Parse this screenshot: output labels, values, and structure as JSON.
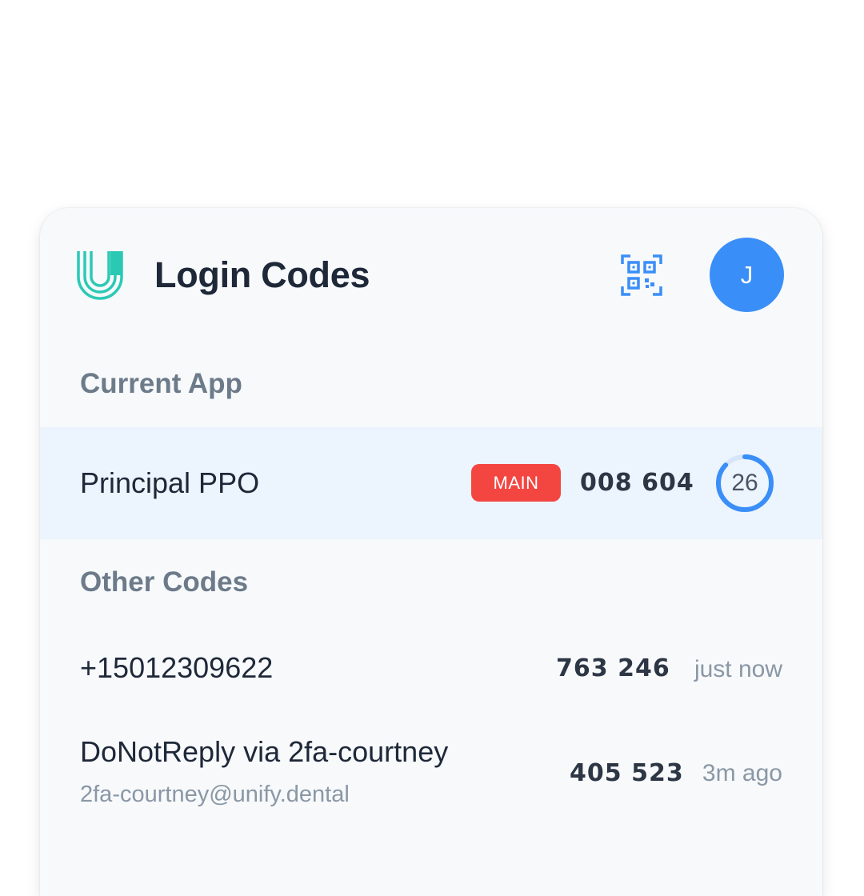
{
  "header": {
    "title": "Login Codes",
    "avatar_initial": "J",
    "icons": {
      "logo": "unify-logo",
      "scan": "qr-code-icon"
    }
  },
  "current_app": {
    "section_label": "Current App",
    "name": "Principal PPO",
    "badge": "MAIN",
    "code": "008 604",
    "seconds_remaining": "26",
    "timer_fraction_remaining": 0.87
  },
  "other_codes": {
    "section_label": "Other Codes",
    "items": [
      {
        "name": "+15012309622",
        "code": "763 246",
        "time": "just now"
      },
      {
        "name": "DoNotReply via 2fa-courtney",
        "subtitle": "2fa-courtney@unify.dental",
        "code": "405 523",
        "time": "3m ago"
      }
    ]
  },
  "colors": {
    "accent": "#3a8ef8",
    "badge": "#f44641",
    "logo": "#2bc9b4",
    "selected_row": "#ecf4fe"
  }
}
